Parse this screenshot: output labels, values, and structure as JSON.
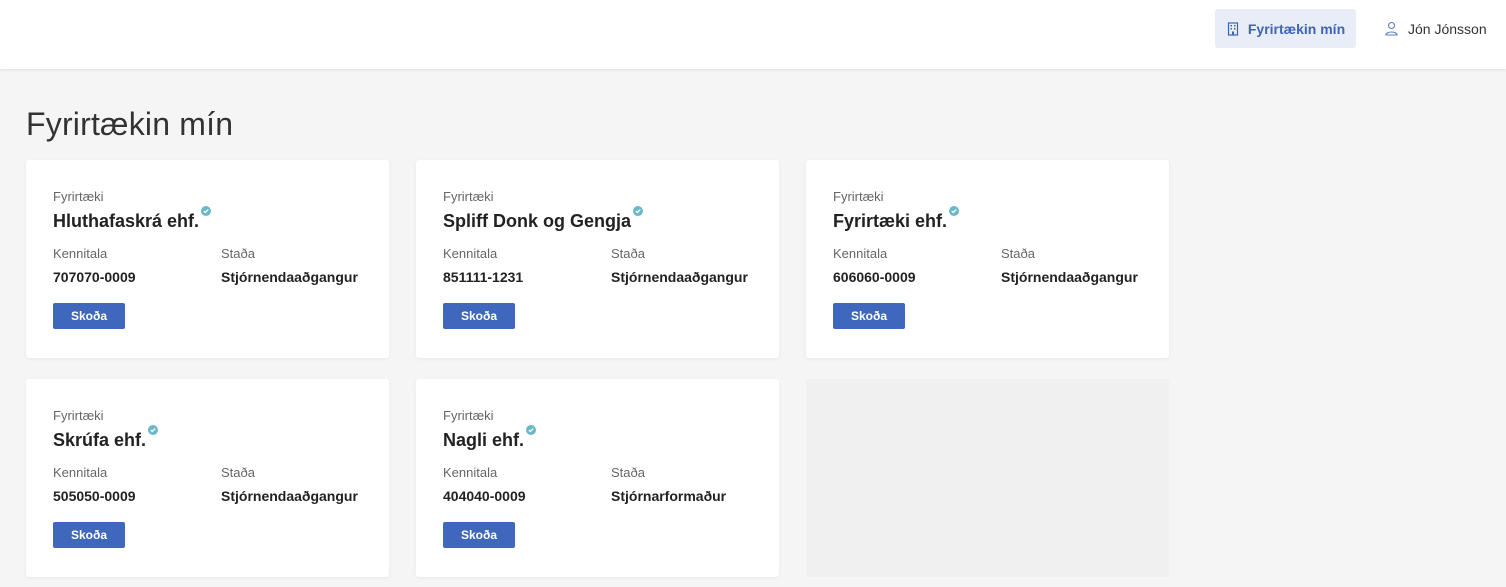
{
  "header": {
    "companies_label": "Fyrirtækin mín",
    "companies_icon": "building-icon",
    "user_name": "Jón Jónsson",
    "user_icon": "user-icon",
    "accent_color": "#3f63b8"
  },
  "page": {
    "title": "Fyrirtækin mín"
  },
  "labels": {
    "company": "Fyrirtæki",
    "id": "Kennitala",
    "status": "Staða",
    "view": "Skoða"
  },
  "companies": [
    {
      "name": "Hluthafaskrá ehf.",
      "id": "707070-0009",
      "status": "Stjórnendaaðgangur"
    },
    {
      "name": "Spliff Donk og Gengja",
      "id": "851111-1231",
      "status": "Stjórnendaaðgangur"
    },
    {
      "name": "Fyrirtæki ehf.",
      "id": "606060-0009",
      "status": "Stjórnendaaðgangur"
    },
    {
      "name": "Skrúfa ehf.",
      "id": "505050-0009",
      "status": "Stjórnendaaðgangur"
    },
    {
      "name": "Nagli ehf.",
      "id": "404040-0009",
      "status": "Stjórnarformaður"
    }
  ],
  "colors": {
    "button": "#3f67bb",
    "verified": "#6ab8c9"
  }
}
